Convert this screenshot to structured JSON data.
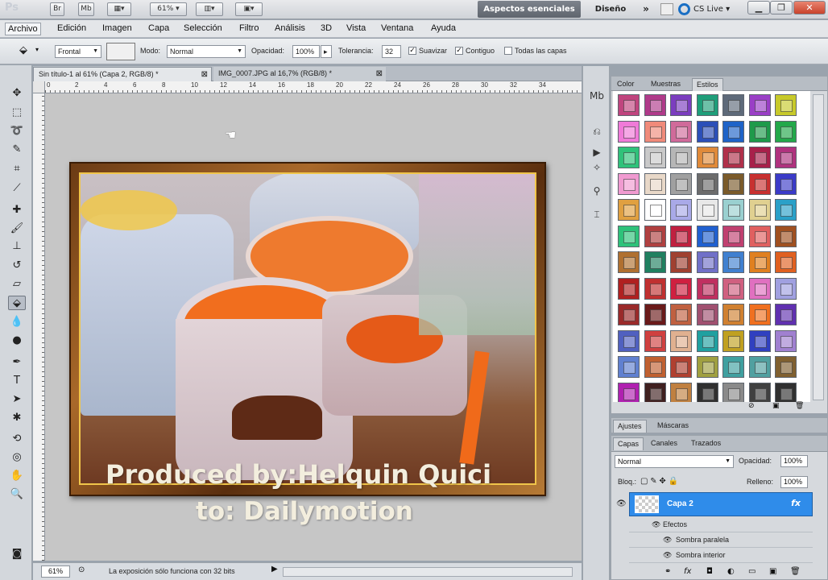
{
  "app": {
    "logo_text": "Ps"
  },
  "titlebar": {
    "zoom": "61%",
    "workspace_active": "Aspectos esenciales",
    "workspace_other": "Diseño",
    "more": "»",
    "cslive": "CS Live"
  },
  "menubar": {
    "items": [
      "Archivo",
      "Edición",
      "Imagen",
      "Capa",
      "Selección",
      "Filtro",
      "Análisis",
      "3D",
      "Vista",
      "Ventana",
      "Ayuda"
    ]
  },
  "options": {
    "fill_source": "Frontal",
    "mode_label": "Modo:",
    "mode_value": "Normal",
    "opacity_label": "Opacidad:",
    "opacity_value": "100%",
    "tolerance_label": "Tolerancia:",
    "tolerance_value": "32",
    "antialias_label": "Suavizar",
    "contiguous_label": "Contiguo",
    "all_layers_label": "Todas las capas",
    "antialias_checked": true,
    "contiguous_checked": true,
    "all_layers_checked": false
  },
  "documents": {
    "tabs": [
      {
        "label": "Sin título-1 al 61% (Capa 2, RGB/8) *",
        "active": true
      },
      {
        "label": "IMG_0007.JPG al 16,7% (RGB/8) *",
        "active": false
      }
    ],
    "ruler_marks": [
      "0",
      "2",
      "4",
      "6",
      "8",
      "10",
      "12",
      "14",
      "16",
      "18",
      "20",
      "22",
      "24",
      "26",
      "28",
      "30",
      "32",
      "34"
    ]
  },
  "canvas": {
    "credit_line_1": "Produced by:Helquin Quici",
    "credit_line_2": "to: Dailymotion"
  },
  "status": {
    "zoom": "61%",
    "message": "La exposición sólo funciona con 32 bits"
  },
  "styles_panel": {
    "tabs": [
      "Color",
      "Muestras",
      "Estilos"
    ],
    "active_tab": "Estilos",
    "swatch_colors": [
      "#c0447e",
      "#b03a8a",
      "#7b3dbf",
      "#1f9e7a",
      "#5e6a7a",
      "#9a3fc6",
      "#c7c92a",
      "#f07ad8",
      "#f08a7a",
      "#d06a9a",
      "#2b4fb8",
      "#1e63c8",
      "#1e9a4a",
      "#23a84a",
      "#2fc27a",
      "#c9c9c9",
      "#b6b6b6",
      "#e08a3a",
      "#b0304a",
      "#a8204a",
      "#b0327e",
      "#f09ad0",
      "#e8d8c8",
      "#a0a0a0",
      "#6c6c6c",
      "#7a5a2a",
      "#c83030",
      "#3b3bc8",
      "#e0a040",
      "#ffffff",
      "#a9a9e8",
      "#e8e8e8",
      "#9ad0d0",
      "#e0d090",
      "#2aa0c8",
      "#2ec27a",
      "#b04040",
      "#c02040",
      "#2060d0",
      "#c04070",
      "#e06060",
      "#a05020",
      "#b07030",
      "#208060",
      "#a04030",
      "#7070c8",
      "#4080d0",
      "#e08020",
      "#e06020",
      "#b02020",
      "#c03030",
      "#d02040",
      "#c03060",
      "#d06080",
      "#e070c0",
      "#a0a0e0",
      "#9a2a2a",
      "#6a1a1a",
      "#c06040",
      "#a05070",
      "#d08030",
      "#f07020",
      "#6030b0",
      "#5060c0",
      "#d04040",
      "#e0b090",
      "#20a0a0",
      "#c0a020",
      "#3040c0",
      "#a080d0",
      "#6080d0",
      "#c06030",
      "#b04030",
      "#a0a040",
      "#40a0a0",
      "#50a0a0",
      "#806030",
      "#b020b0",
      "#402020",
      "#c08040",
      "#303030",
      "#8a8a8a",
      "#404040",
      "#303030"
    ]
  },
  "adjust_tabs": [
    "Ajustes",
    "Máscaras"
  ],
  "layers_panel": {
    "tabs": [
      "Capas",
      "Canales",
      "Trazados"
    ],
    "active_tab": "Capas",
    "blend_mode": "Normal",
    "opacity_label": "Opacidad:",
    "opacity_value": "100%",
    "lock_label": "Bloq.:",
    "fill_label": "Relleno:",
    "fill_value": "100%",
    "layer_name": "Capa 2",
    "fx_badge": "fx",
    "effects_label": "Efectos",
    "effects": [
      "Sombra paralela",
      "Sombra interior"
    ]
  }
}
